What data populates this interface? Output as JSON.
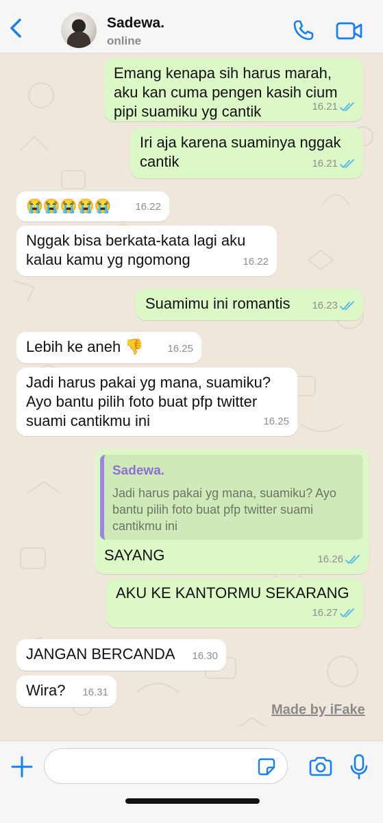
{
  "header": {
    "contact_name": "Sadewa.",
    "status": "online",
    "icons": [
      "chevron-left-icon",
      "phone-icon",
      "video-camera-icon"
    ]
  },
  "messages": [
    {
      "dir": "out",
      "text": "Emang kenapa sih harus marah,\naku kan cuma pengen kasih cium\npipi suamiku yg cantik",
      "time": "16.21",
      "read": true
    },
    {
      "dir": "out",
      "text": "Iri aja karena suaminya nggak\ncantik",
      "time": "16.21",
      "read": true
    },
    {
      "dir": "in",
      "text": "😭😭😭😭😭",
      "time": "16.22"
    },
    {
      "dir": "in",
      "text": "Nggak bisa berkata-kata lagi aku\nkalau kamu yg ngomong",
      "time": "16.22"
    },
    {
      "dir": "out",
      "text": "Suamimu ini romantis",
      "time": "16.23",
      "read": true
    },
    {
      "dir": "in",
      "text": "Lebih ke aneh 👎",
      "time": "16.25"
    },
    {
      "dir": "in",
      "text": "Jadi harus pakai yg mana, suamiku?\nAyo bantu pilih foto buat pfp twitter\nsuami cantikmu ini",
      "time": "16.25"
    },
    {
      "dir": "out",
      "reply_to": {
        "name": "Sadewa.",
        "text": "Jadi harus pakai yg mana, suamiku? Ayo bantu pilih foto buat pfp twitter suami cantikmu ini"
      },
      "text": "SAYANG",
      "time": "16.26",
      "read": true
    },
    {
      "dir": "out",
      "text": "AKU KE KANTORMU SEKARANG",
      "time": "16.27",
      "read": true
    },
    {
      "dir": "in",
      "text": "JANGAN BERCANDA",
      "time": "16.30"
    },
    {
      "dir": "in",
      "text": "Wira?",
      "time": "16.31"
    }
  ],
  "watermark": "Made by iFake",
  "input_bar": {
    "placeholder": "",
    "icons": [
      "plus-icon",
      "sticker-icon",
      "camera-icon",
      "microphone-icon"
    ]
  },
  "colors": {
    "accent": "#147efb",
    "outgoing_bubble": "#dcf8c6",
    "incoming_bubble": "#ffffff",
    "wallpaper": "#efe7dc",
    "read_ticks": "#4fb6ec",
    "quote_bar": "#9b85e6"
  }
}
